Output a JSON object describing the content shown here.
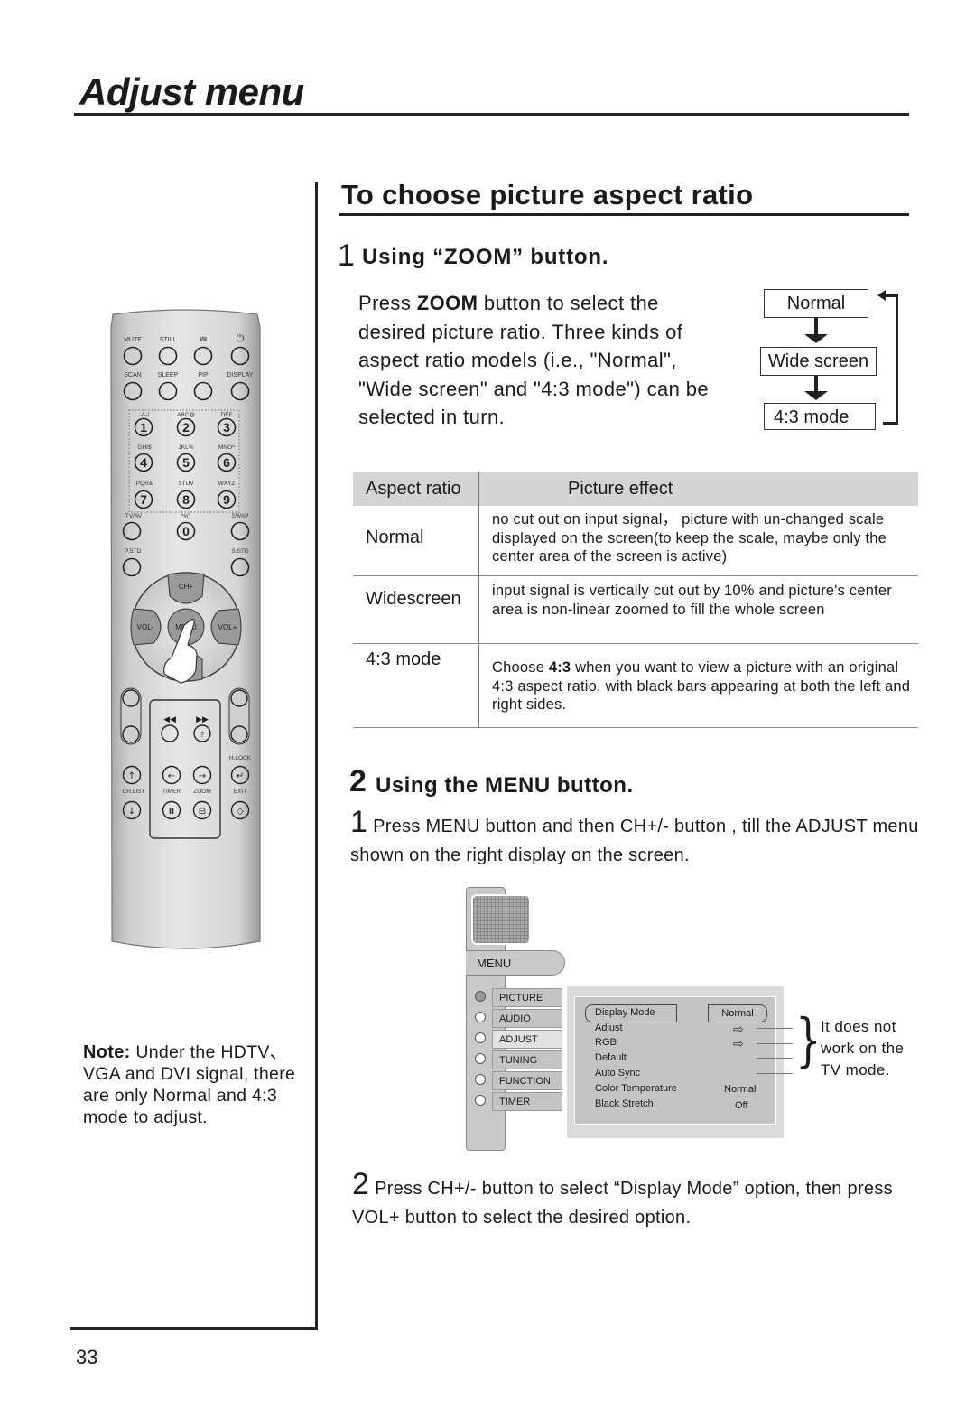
{
  "header": {
    "page_title": "Adjust menu",
    "page_number": "33"
  },
  "section": {
    "title": "To choose picture aspect ratio"
  },
  "step1": {
    "number": "1",
    "title": "Using “ZOOM” button.",
    "para_prefix": "Press ",
    "para_bold": "ZOOM",
    "para_rest": " button to select the desired picture ratio. Three kinds of aspect ratio models (i.e., \"Normal\", \"Wide screen\" and \"4:3 mode\") can be selected in turn."
  },
  "flow": {
    "items": [
      "Normal",
      "Wide screen",
      "4:3 mode"
    ]
  },
  "table": {
    "headers": [
      "Aspect ratio",
      "Picture  effect"
    ],
    "rows": [
      {
        "ratio": "Normal",
        "effect": "no cut out on input signal， picture with un-changed scale displayed on the screen(to keep the scale, maybe only the center area of the screen is active)"
      },
      {
        "ratio": "Widescreen",
        "effect": "input signal is vertically cut out by 10% and picture's center area is non-linear zoomed to fill the whole screen"
      },
      {
        "ratio": "4:3 mode",
        "effect_prefix": "Choose ",
        "effect_bold": "4:3",
        "effect_rest": " when you want to view a picture with an original 4:3 aspect ratio, with black bars appearing at both the left and right sides."
      }
    ]
  },
  "step2": {
    "number": "2",
    "title": "Using the MENU button.",
    "sub1_num": "1",
    "sub1_text": " Press MENU button and then CH+/- button , till the ADJUST menu shown on the right display on the screen.",
    "sub2_num": "2",
    "sub2_text": " Press CH+/- button to select “Display Mode” option, then press VOL+ button to select the desired option."
  },
  "osd": {
    "menu_label": "MENU",
    "tabs": [
      {
        "label": "PICTURE",
        "active": false
      },
      {
        "label": "AUDIO",
        "active": false
      },
      {
        "label": "ADJUST",
        "active": true
      },
      {
        "label": "TUNING",
        "active": false
      },
      {
        "label": "FUNCTION",
        "active": false
      },
      {
        "label": "TIMER",
        "active": false
      }
    ],
    "items": [
      {
        "label": "Display Mode",
        "value": "Normal"
      },
      {
        "label": "Adjust",
        "value": "arrow-right-icon"
      },
      {
        "label": "RGB",
        "value": "arrow-right-icon"
      },
      {
        "label": "Default",
        "value": ""
      },
      {
        "label": "Auto Sync",
        "value": ""
      },
      {
        "label": "Color Temperature",
        "value": "Normal"
      },
      {
        "label": "Black Stretch",
        "value": "Off"
      }
    ],
    "side_note": "It does not work on the TV mode."
  },
  "remote": {
    "row1_labels": [
      "MUTE",
      "STILL",
      "I/II",
      "power-icon"
    ],
    "row2_labels": [
      "SCAN",
      "SLEEP",
      "PIP",
      "DISPLAY"
    ],
    "digit_labels": [
      "-/--!",
      "ABC@",
      "DEF",
      "GHI$",
      "JKL%",
      "MNO^",
      "PQR&",
      "STUV",
      "WXYZ"
    ],
    "digits": [
      "1",
      "2",
      "3",
      "4",
      "5",
      "6",
      "7",
      "8",
      "9",
      "0"
    ],
    "tvav": "TV/AV",
    "zero_label": "*#()",
    "swap": "SWAP",
    "pstd": "P.STD",
    "sstd": "S.STD",
    "ch_plus": "CH+",
    "vol_minus": "VOL-",
    "menu": "MENU",
    "vol_plus": "VOL+",
    "hlock": "H.LOCK",
    "chlist": "CH.LIST",
    "timer": "TIMER",
    "zoom": "ZOOM",
    "exit": "EXIT"
  },
  "note": {
    "bold": "Note:",
    "text": " Under the HDTV、VGA and DVI signal, there are only Normal and 4:3 mode to adjust."
  }
}
